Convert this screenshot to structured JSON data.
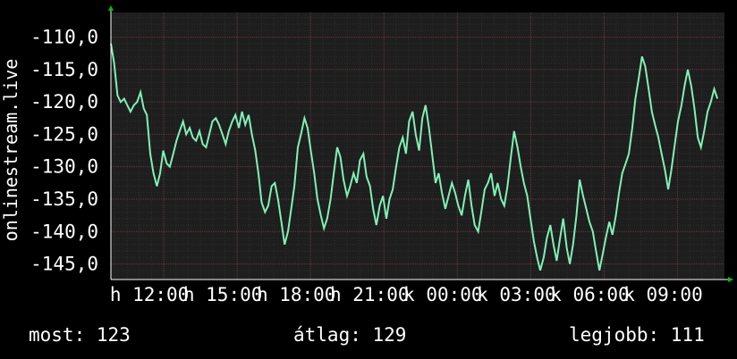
{
  "colors": {
    "background": "#000000",
    "plot_background": "#1e1e1e",
    "grid_minor": "#2d2d2d",
    "grid_major": "#6a3a3a",
    "line": "#80f0b8",
    "axis_arrow": "#00c000",
    "text": "#ffffff"
  },
  "legend": {
    "current_label": "most: 123",
    "average_label": "átlag: 129",
    "best_label": "legjobb: 111"
  },
  "chart_data": {
    "type": "line",
    "title": "",
    "xlabel": "",
    "ylabel": "onlinestream.live",
    "x_tick_labels": [
      "h 12:00",
      "h 15:00",
      "h 18:00",
      "h 21:00",
      "k 00:00",
      "k 03:00",
      "k 06:00",
      "k 09:00"
    ],
    "x_tick_hours": [
      12,
      15,
      18,
      21,
      24,
      27,
      30,
      33
    ],
    "xlim": [
      9.84,
      34.92
    ],
    "y_ticks": [
      -110,
      -115,
      -120,
      -125,
      -130,
      -135,
      -140,
      -145
    ],
    "y_tick_labels": [
      "-110,0",
      "-115,0",
      "-120,0",
      "-125,0",
      "-130,0",
      "-135,0",
      "-140,0",
      "-145,0"
    ],
    "ylim": [
      -147.4,
      -106.2
    ],
    "grid": true,
    "series": [
      {
        "x_hours": [
          9.84,
          9.97,
          10.11,
          10.24,
          10.38,
          10.51,
          10.64,
          10.78,
          10.91,
          11.05,
          11.18,
          11.31,
          11.45,
          11.58,
          11.72,
          11.85,
          11.98,
          12.12,
          12.25,
          12.39,
          12.52,
          12.65,
          12.79,
          12.92,
          13.06,
          13.19,
          13.32,
          13.46,
          13.59,
          13.73,
          13.86,
          13.99,
          14.13,
          14.26,
          14.4,
          14.53,
          14.66,
          14.8,
          14.93,
          15.07,
          15.2,
          15.33,
          15.47,
          15.6,
          15.74,
          15.87,
          16.0,
          16.14,
          16.27,
          16.41,
          16.54,
          16.67,
          16.81,
          16.94,
          17.08,
          17.21,
          17.34,
          17.48,
          17.61,
          17.75,
          17.88,
          18.01,
          18.15,
          18.28,
          18.42,
          18.55,
          18.68,
          18.82,
          18.95,
          19.09,
          19.22,
          19.35,
          19.49,
          19.62,
          19.76,
          19.89,
          20.02,
          20.16,
          20.29,
          20.43,
          20.56,
          20.69,
          20.83,
          20.96,
          21.1,
          21.23,
          21.36,
          21.5,
          21.63,
          21.77,
          21.9,
          22.03,
          22.17,
          22.3,
          22.44,
          22.57,
          22.7,
          22.84,
          22.97,
          23.11,
          23.24,
          23.37,
          23.51,
          23.64,
          23.78,
          23.91,
          24.04,
          24.18,
          24.31,
          24.45,
          24.58,
          24.71,
          24.85,
          24.98,
          25.12,
          25.25,
          25.38,
          25.52,
          25.65,
          25.79,
          25.92,
          26.05,
          26.19,
          26.32,
          26.46,
          26.59,
          26.72,
          26.86,
          26.99,
          27.13,
          27.26,
          27.39,
          27.53,
          27.66,
          27.8,
          27.93,
          28.06,
          28.2,
          28.33,
          28.47,
          28.6,
          28.73,
          28.87,
          29.0,
          29.14,
          29.27,
          29.4,
          29.54,
          29.67,
          29.81,
          29.94,
          30.07,
          30.21,
          30.34,
          30.48,
          30.61,
          30.74,
          30.88,
          31.01,
          31.15,
          31.28,
          31.41,
          31.55,
          31.68,
          31.82,
          31.95,
          32.08,
          32.22,
          32.35,
          32.49,
          32.62,
          32.75,
          32.89,
          33.02,
          33.16,
          33.29,
          33.42,
          33.56,
          33.69,
          33.83,
          33.96,
          34.09,
          34.23,
          34.36,
          34.5,
          34.63,
          34.76,
          34.9
        ],
        "values": [
          -111.0,
          -114.0,
          -119.0,
          -120.0,
          -119.5,
          -120.5,
          -121.5,
          -120.5,
          -120.0,
          -118.5,
          -121.0,
          -122.0,
          -128.0,
          -131.0,
          -133.0,
          -131.0,
          -127.5,
          -129.5,
          -130.0,
          -128.0,
          -126.0,
          -124.5,
          -123.0,
          -125.0,
          -124.0,
          -125.5,
          -126.0,
          -124.5,
          -126.5,
          -127.0,
          -125.0,
          -123.0,
          -122.5,
          -123.5,
          -125.0,
          -126.5,
          -124.5,
          -123.0,
          -122.0,
          -124.0,
          -121.5,
          -123.5,
          -122.0,
          -125.0,
          -127.5,
          -131.0,
          -135.5,
          -137.0,
          -136.0,
          -133.0,
          -132.5,
          -135.0,
          -138.5,
          -142.0,
          -140.0,
          -136.5,
          -133.0,
          -127.0,
          -125.0,
          -122.5,
          -124.0,
          -127.5,
          -131.0,
          -135.0,
          -137.5,
          -139.5,
          -138.0,
          -135.0,
          -131.0,
          -127.0,
          -128.5,
          -132.0,
          -134.5,
          -133.0,
          -131.0,
          -132.5,
          -129.0,
          -128.0,
          -131.5,
          -133.0,
          -136.5,
          -139.0,
          -136.0,
          -134.5,
          -138.0,
          -135.0,
          -133.5,
          -130.0,
          -127.0,
          -125.5,
          -128.0,
          -123.0,
          -121.5,
          -125.0,
          -127.5,
          -122.5,
          -120.5,
          -124.0,
          -128.0,
          -132.5,
          -131.0,
          -134.0,
          -136.5,
          -134.5,
          -132.5,
          -134.0,
          -136.0,
          -137.5,
          -134.5,
          -132.0,
          -136.0,
          -139.0,
          -140.0,
          -137.0,
          -133.5,
          -132.5,
          -131.0,
          -134.5,
          -132.5,
          -135.0,
          -136.0,
          -133.0,
          -128.5,
          -124.5,
          -127.0,
          -130.0,
          -132.5,
          -134.5,
          -138.0,
          -141.5,
          -144.0,
          -146.0,
          -144.0,
          -141.0,
          -139.0,
          -142.0,
          -144.5,
          -141.0,
          -138.0,
          -142.5,
          -145.0,
          -142.0,
          -137.5,
          -132.0,
          -134.5,
          -136.5,
          -138.5,
          -140.0,
          -143.0,
          -146.0,
          -143.5,
          -141.0,
          -138.5,
          -140.5,
          -137.5,
          -134.0,
          -131.0,
          -129.5,
          -128.0,
          -124.0,
          -119.5,
          -116.5,
          -113.0,
          -114.5,
          -118.0,
          -121.5,
          -123.5,
          -125.5,
          -128.0,
          -130.5,
          -133.5,
          -130.5,
          -126.5,
          -123.0,
          -120.5,
          -117.5,
          -115.0,
          -117.5,
          -121.0,
          -125.5,
          -127.0,
          -124.5,
          -121.5,
          -120.0,
          -118.0,
          -119.5
        ]
      }
    ]
  }
}
